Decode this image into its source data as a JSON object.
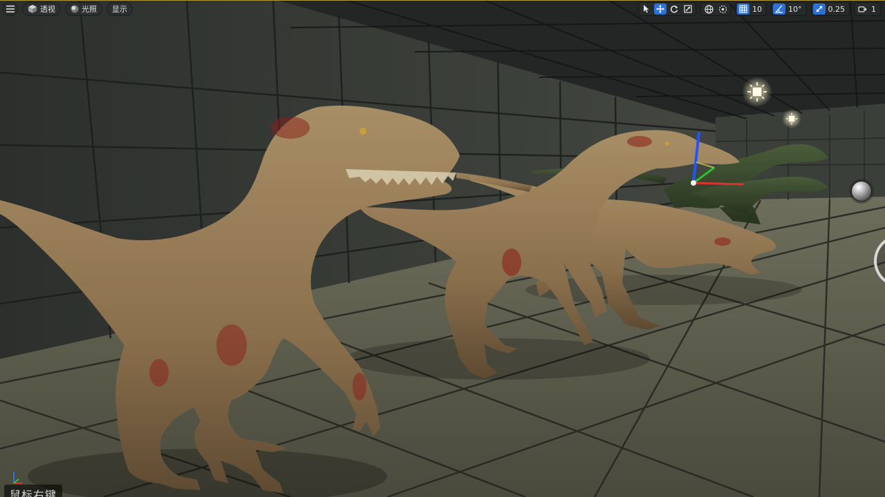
{
  "toolbar_left": {
    "menu_icon": "hamburger-icon",
    "perspective": {
      "icon": "cube-icon",
      "label": "透视"
    },
    "lighting": {
      "icon": "sphere-icon",
      "label": "光照"
    },
    "show": {
      "label": "显示"
    }
  },
  "toolbar_right": {
    "transform_tools": [
      "select-arrow-icon",
      "move-icon",
      "rotate-icon",
      "scale-icon"
    ],
    "active_tool": "move-icon",
    "grid_snap_value": "10",
    "angle_snap_value": "10°",
    "scale_snap_value": "0.25",
    "camera_speed_value": "1"
  },
  "overlay": {
    "bottom_label": "鼠标右键"
  },
  "colors": {
    "active_blue": "#2a72d8",
    "toolbar_bg": "#2a2c2d",
    "top_border": "#b59a3a"
  }
}
